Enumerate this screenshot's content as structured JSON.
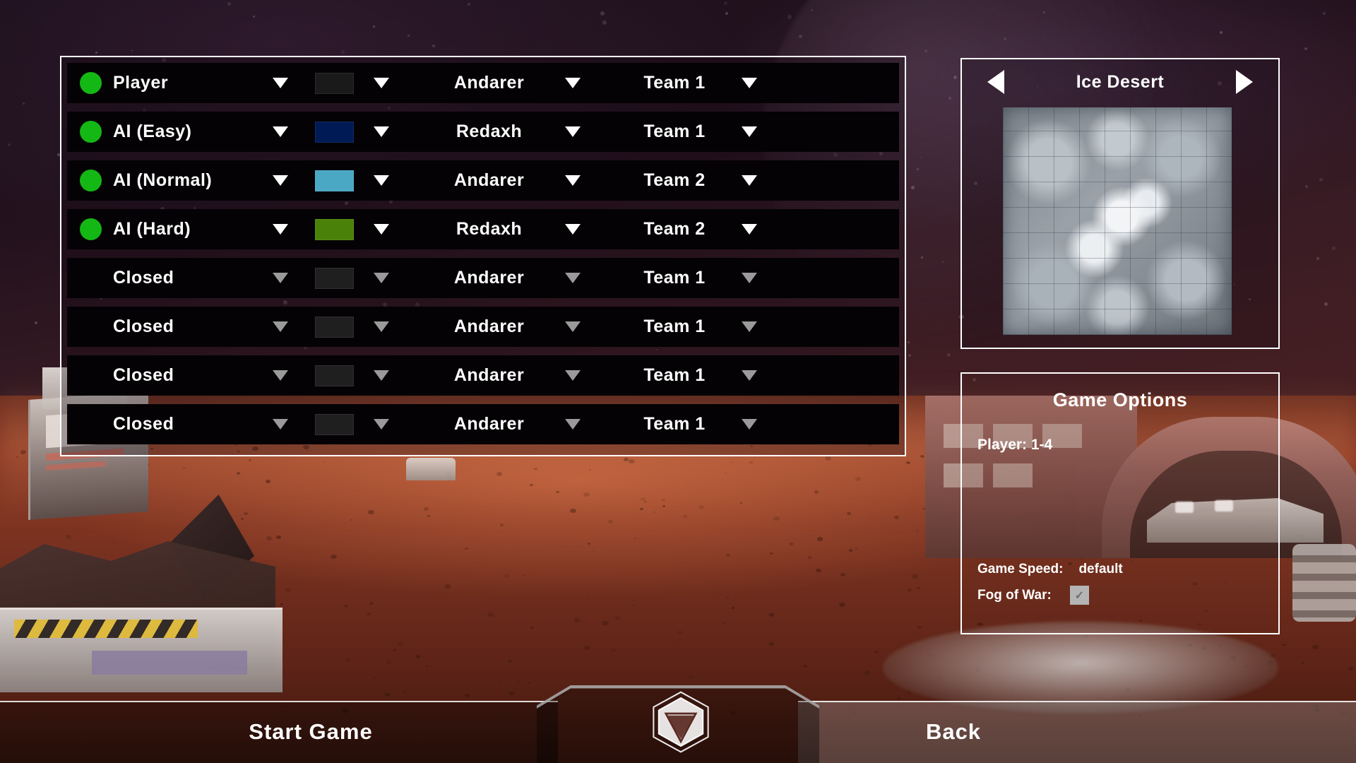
{
  "slots": {
    "columns": [
      "status",
      "type",
      "color",
      "faction",
      "team"
    ],
    "rows": [
      {
        "active": true,
        "type": "Player",
        "color": "#1a1a1a",
        "faction": "Andarer",
        "team": "Team 1"
      },
      {
        "active": true,
        "type": "AI (Easy)",
        "color": "#001a55",
        "faction": "Redaxh",
        "team": "Team 1"
      },
      {
        "active": true,
        "type": "AI (Normal)",
        "color": "#4aa8c4",
        "faction": "Andarer",
        "team": "Team 2"
      },
      {
        "active": true,
        "type": "AI (Hard)",
        "color": "#4a8209",
        "faction": "Redaxh",
        "team": "Team 2"
      },
      {
        "active": false,
        "type": "Closed",
        "color": "#1f1f1f",
        "faction": "Andarer",
        "team": "Team 1"
      },
      {
        "active": false,
        "type": "Closed",
        "color": "#1f1f1f",
        "faction": "Andarer",
        "team": "Team 1"
      },
      {
        "active": false,
        "type": "Closed",
        "color": "#1f1f1f",
        "faction": "Andarer",
        "team": "Team 1"
      },
      {
        "active": false,
        "type": "Closed",
        "color": "#1f1f1f",
        "faction": "Andarer",
        "team": "Team 1"
      }
    ]
  },
  "map": {
    "name": "Ice Desert",
    "prev_icon": "arrow-left-icon",
    "next_icon": "arrow-right-icon"
  },
  "options": {
    "title": "Game Options",
    "players_label": "Player: 1-4",
    "game_speed_label": "Game Speed:",
    "game_speed_value": "default",
    "fog_of_war_label": "Fog of War:",
    "fog_of_war_checked": true,
    "check_glyph": "✓"
  },
  "bottom_bar": {
    "start_label": "Start Game",
    "back_label": "Back",
    "logo_icon": "hexagon-triangle-logo-icon"
  },
  "colors": {
    "status_active": "#14b814",
    "panel_border": "#ffffff",
    "row_background": "#040204",
    "text": "#ffffff",
    "caret_active": "#ffffff",
    "caret_disabled": "#9a9a9a"
  }
}
